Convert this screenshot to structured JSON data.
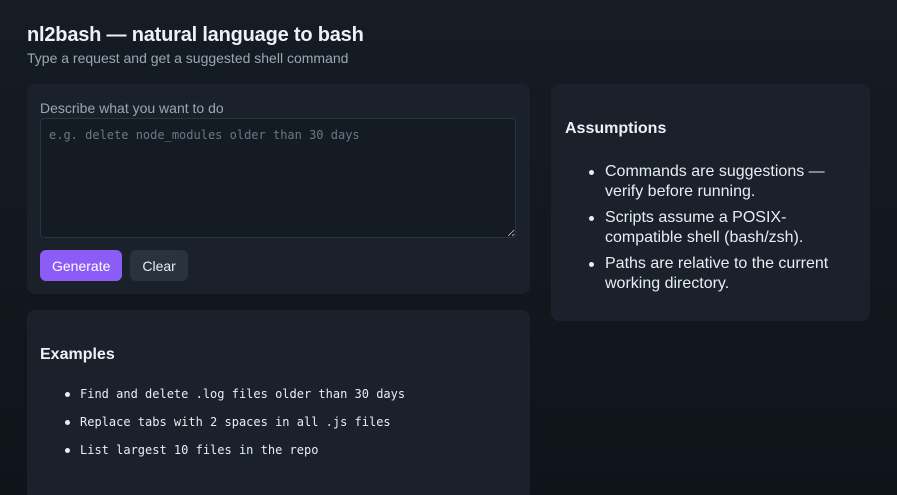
{
  "header": {
    "title": "nl2bash — natural language to bash",
    "subtitle": "Type a request and get a suggested shell command"
  },
  "input_card": {
    "label": "Describe what you want to do",
    "placeholder": "e.g. delete node_modules older than 30 days",
    "value": "",
    "generate_label": "Generate",
    "clear_label": "Clear"
  },
  "examples_card": {
    "heading": "Examples",
    "items": [
      "Find and delete .log files older than 30 days",
      "Replace tabs with 2 spaces in all .js files",
      "List largest 10 files in the repo"
    ]
  },
  "assumptions_card": {
    "heading": "Assumptions",
    "items": [
      "Commands are suggestions — verify before running.",
      "Scripts assume a POSIX-compatible shell (bash/zsh).",
      "Paths are relative to the current working directory."
    ]
  },
  "colors": {
    "accent": "#8b5cf6",
    "background": "#121820",
    "card": "#1a212b"
  }
}
